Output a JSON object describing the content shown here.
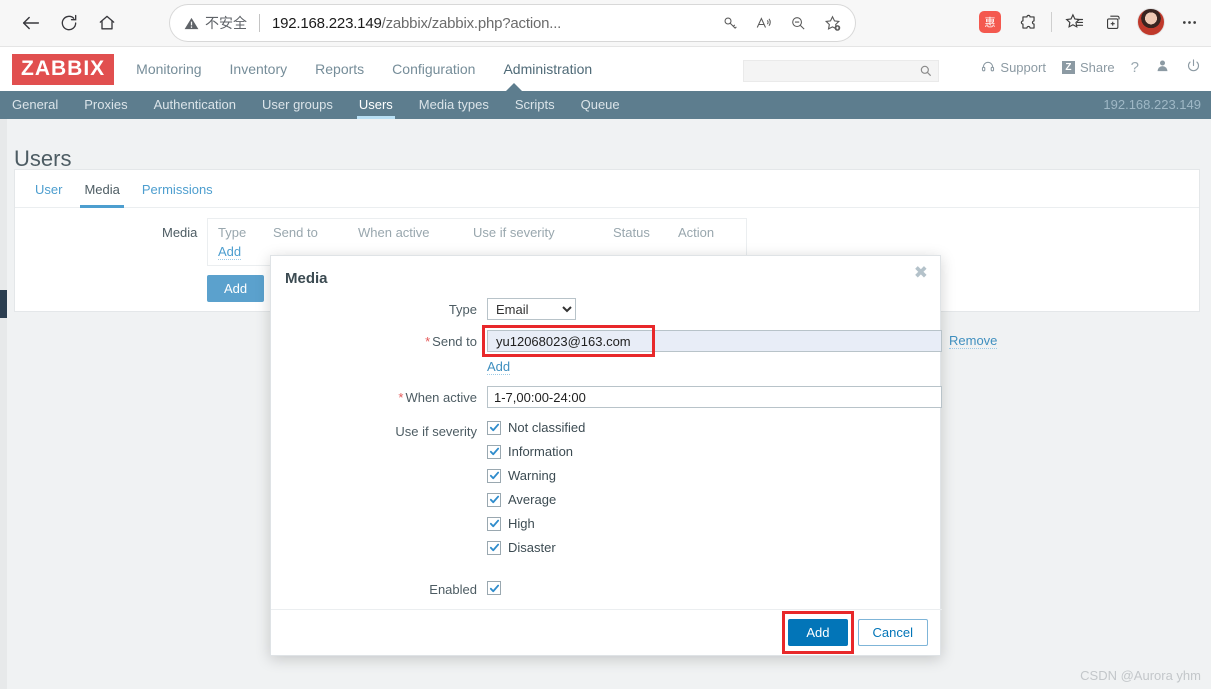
{
  "browser": {
    "back_icon": "back-arrow-icon",
    "reload_icon": "reload-icon",
    "home_icon": "home-icon",
    "security_label": "不安全",
    "url": "192.168.223.149/zabbix/zabbix.php?action...",
    "url_host": "192.168.223.149",
    "url_path": "/zabbix/zabbix.php?action...",
    "omni_icons": [
      "key-icon",
      "read-aloud-icon",
      "zoom-out-icon",
      "add-favorite-icon"
    ],
    "toolbar_icons": [
      "extension-red-icon",
      "extension-puzzle-icon",
      "favorites-icon",
      "collections-icon",
      "avatar",
      "more-icon"
    ],
    "ext_badge_text": "惠",
    "more_label": "···"
  },
  "zabbix": {
    "logo": "ZABBIX",
    "main_nav": [
      {
        "label": "Monitoring",
        "active": false
      },
      {
        "label": "Inventory",
        "active": false
      },
      {
        "label": "Reports",
        "active": false
      },
      {
        "label": "Configuration",
        "active": false
      },
      {
        "label": "Administration",
        "active": true
      }
    ],
    "search_placeholder": "",
    "search_value": "",
    "header_links": {
      "support": "Support",
      "share": "Share",
      "share_badge": "Z",
      "help": "?",
      "user_icon": "user-icon",
      "signout_icon": "power-icon"
    },
    "sub_nav": [
      {
        "label": "General",
        "active": false
      },
      {
        "label": "Proxies",
        "active": false
      },
      {
        "label": "Authentication",
        "active": false
      },
      {
        "label": "User groups",
        "active": false
      },
      {
        "label": "Users",
        "active": true
      },
      {
        "label": "Media types",
        "active": false
      },
      {
        "label": "Scripts",
        "active": false
      },
      {
        "label": "Queue",
        "active": false
      }
    ],
    "server_ip": "192.168.223.149"
  },
  "page": {
    "title": "Users",
    "tabs": [
      {
        "label": "User",
        "active": false
      },
      {
        "label": "Media",
        "active": true
      },
      {
        "label": "Permissions",
        "active": false
      }
    ],
    "media_field_label": "Media",
    "media_table_headers": [
      "Type",
      "Send to",
      "When active",
      "Use if severity",
      "Status",
      "Action"
    ],
    "media_add_link": "Add",
    "form_buttons": {
      "add": "Add",
      "secondary": ""
    }
  },
  "modal": {
    "title": "Media",
    "close_label": "✖",
    "type_label": "Type",
    "type_value": "Email",
    "type_options": [
      "Email"
    ],
    "sendto_label": "Send to",
    "sendto_value": "yu12068023@163.com",
    "sendto_remove": "Remove",
    "sendto_add": "Add",
    "whenactive_label": "When active",
    "whenactive_value": "1-7,00:00-24:00",
    "severity_label": "Use if severity",
    "severities": [
      {
        "label": "Not classified",
        "checked": true
      },
      {
        "label": "Information",
        "checked": true
      },
      {
        "label": "Warning",
        "checked": true
      },
      {
        "label": "Average",
        "checked": true
      },
      {
        "label": "High",
        "checked": true
      },
      {
        "label": "Disaster",
        "checked": true
      }
    ],
    "enabled_label": "Enabled",
    "enabled_checked": true,
    "add_button": "Add",
    "cancel_button": "Cancel"
  },
  "watermark": "CSDN @Aurora yhm",
  "colors": {
    "brand_red": "#e14f4f",
    "subnav_blue": "#5d7d8e",
    "link_blue": "#4d9ecf",
    "primary_button": "#0275b8",
    "highlight_red": "#e8282a",
    "required_red": "#e45959"
  }
}
